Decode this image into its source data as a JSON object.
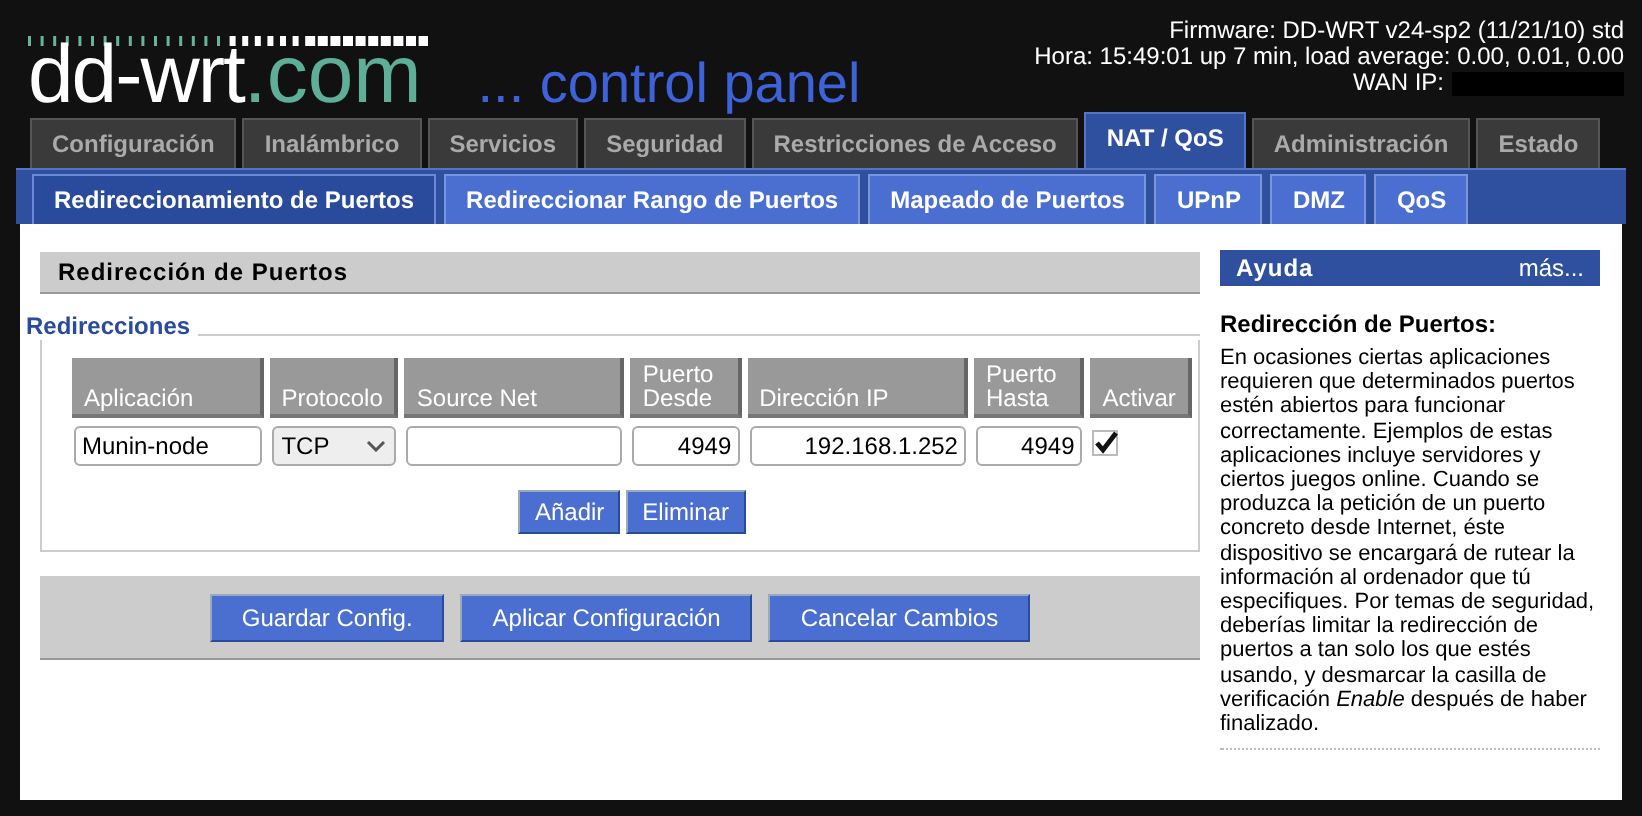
{
  "header": {
    "logo_main": "dd-wrt",
    "logo_domain": ".com",
    "tagline": "... control panel",
    "firmware": "Firmware: DD-WRT v24-sp2 (11/21/10) std",
    "uptime": "Hora: 15:49:01 up 7 min, load average: 0.00, 0.01, 0.00",
    "wan_ip_label": "WAN IP:"
  },
  "tabs": [
    {
      "label": "Configuración",
      "selected": false
    },
    {
      "label": "Inalámbrico",
      "selected": false
    },
    {
      "label": "Servicios",
      "selected": false
    },
    {
      "label": "Seguridad",
      "selected": false
    },
    {
      "label": "Restricciones de Acceso",
      "selected": false
    },
    {
      "label": "NAT / QoS",
      "selected": true
    },
    {
      "label": "Administración",
      "selected": false
    },
    {
      "label": "Estado",
      "selected": false
    }
  ],
  "subtabs": [
    {
      "label": "Redireccionamiento de Puertos",
      "selected": true
    },
    {
      "label": "Redireccionar Rango de Puertos",
      "selected": false
    },
    {
      "label": "Mapeado de Puertos",
      "selected": false
    },
    {
      "label": "UPnP",
      "selected": false
    },
    {
      "label": "DMZ",
      "selected": false
    },
    {
      "label": "QoS",
      "selected": false
    }
  ],
  "section": {
    "title": "Redirección de Puertos",
    "legend": "Redirecciones",
    "columns": [
      "Aplicación",
      "Protocolo",
      "Source Net",
      "Puerto Desde",
      "Dirección IP",
      "Puerto Hasta",
      "Activar"
    ],
    "rows": [
      {
        "application": "Munin-node",
        "protocol": "TCP",
        "port_from": "4949",
        "ip_address": "192.168.1.252",
        "port_to": "4949",
        "checked": true
      }
    ],
    "row_buttons": [
      "Añadir",
      "Eliminar"
    ]
  },
  "footer_buttons": [
    "Guardar Config.",
    "Aplicar Configuración",
    "Cancelar Cambios"
  ],
  "help": {
    "title": "Ayuda",
    "more": "más...",
    "heading": "Redirección de Puertos:",
    "body": "En ocasiones ciertas aplicaciones requieren que determinados puertos estén abiertos para funcionar correctamente. Ejemplos de estas aplicaciones incluye servidores y ciertos juegos online. Cuando se produzca la petición de un puerto concreto desde Internet, éste dispositivo se encargará de rutear la información al ordenador que tú especifiques. Por temas de seguridad, deberías limitar la redirección de puertos a tan solo los que estés usando, y desmarcar la casilla de verificación *Enable* después de haber finalizado."
  }
}
